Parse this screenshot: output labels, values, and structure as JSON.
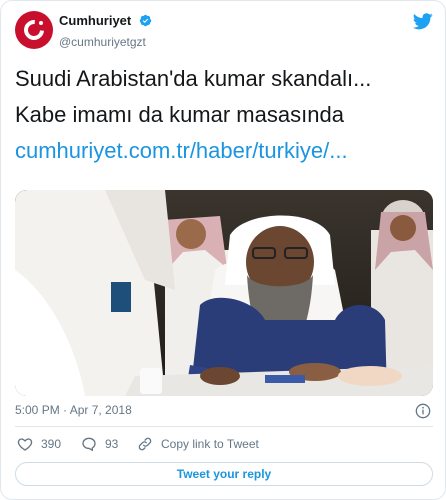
{
  "account": {
    "display_name": "Cumhuriyet",
    "handle": "@cumhuriyetgzt",
    "verified": true,
    "avatar_color": "#c8102e",
    "avatar_icon": "cumhuriyet-logo"
  },
  "tweet": {
    "line1": "Suudi Arabistan'da kumar skandalı...",
    "line2": "Kabe imamı da kumar masasında",
    "link": "cumhuriyet.com.tr/haber/turkiye/..."
  },
  "timestamp": "5:00 PM · Apr 7, 2018",
  "actions": {
    "likes": "390",
    "replies": "93",
    "copy_link": "Copy link to Tweet"
  },
  "reply_button": "Tweet your reply",
  "icons": {
    "brand": "twitter-bird-icon",
    "verified": "verified-badge-icon",
    "info": "info-icon",
    "like": "heart-icon",
    "reply": "reply-bubble-icon",
    "copy": "link-icon"
  },
  "colors": {
    "accent": "#1b95e0",
    "text": "#14171a",
    "muted": "#657786"
  }
}
